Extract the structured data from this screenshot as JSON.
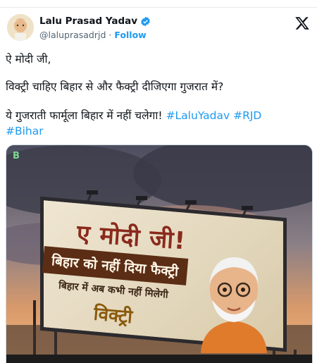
{
  "author": {
    "name": "Lalu Prasad Yadav",
    "handle": "@laluprasadrjd",
    "separator": "·",
    "follow_label": "Follow",
    "verified_icon": "verified-badge-icon"
  },
  "tweet": {
    "line1": "ऐ मोदी जी,",
    "line2": "विक्ट्री चाहिए बिहार से और फैक्ट्री दीजिएगा गुजरात में?",
    "line3_text": "ये गुजराती फार्मूला बिहार में नहीं चलेगा!",
    "hashtags": [
      "#LaluYadav",
      "#RJD",
      "#Bihar"
    ]
  },
  "media": {
    "badge": "B",
    "billboard_title": "ए मोदी जी!",
    "billboard_banner": "बिहार को नहीं दिया फैक्ट्री",
    "billboard_sub": "बिहार में अब कभी नहीं मिलेगी",
    "billboard_victory": "विक्ट्री"
  },
  "colors": {
    "link": "#1d9bf0",
    "text": "#0f1419",
    "muted": "#536471"
  }
}
